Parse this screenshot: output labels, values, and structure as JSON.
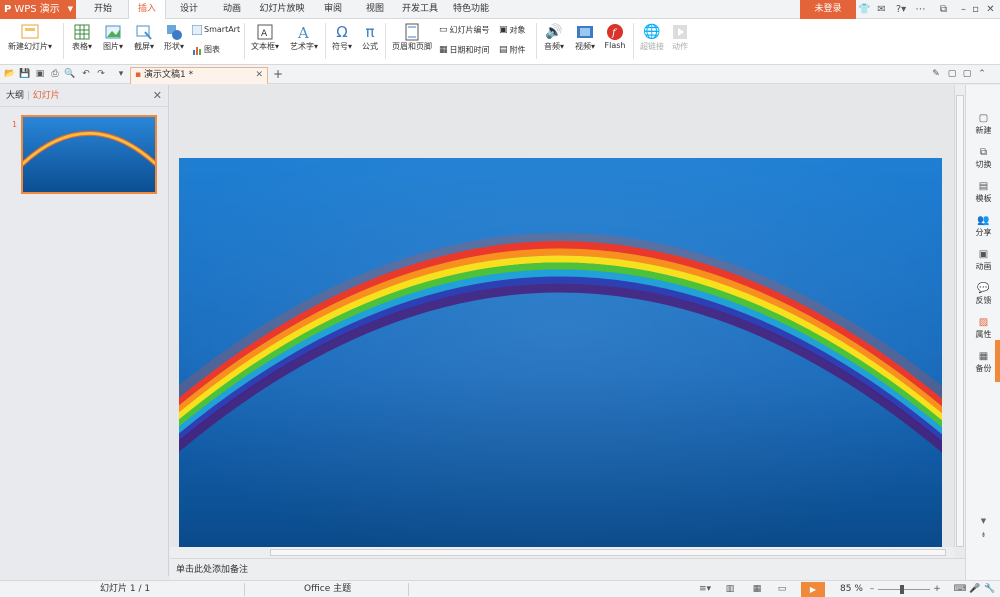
{
  "app": {
    "logo": "P",
    "name": "WPS 演示"
  },
  "menu": {
    "tabs": [
      {
        "label": "开始"
      },
      {
        "label": "插入"
      },
      {
        "label": "设计"
      },
      {
        "label": "动画"
      },
      {
        "label": "幻灯片放映"
      },
      {
        "label": "审阅"
      },
      {
        "label": "视图"
      },
      {
        "label": "开发工具"
      },
      {
        "label": "特色功能"
      }
    ],
    "active": "插入",
    "login_label": "未登录"
  },
  "ribbon": {
    "new_slide": "新建幻灯片",
    "table": "表格",
    "picture": "图片",
    "screenshot": "截屏",
    "shape": "形状",
    "smartart": "SmartArt",
    "chart": "图表",
    "textbox": "文本框",
    "wordart": "艺术字",
    "symbol": "符号",
    "formula": "公式",
    "header_footer": "页眉和页脚",
    "slide_number": "幻灯片编号",
    "datetime": "日期和时间",
    "object": "对象",
    "attachment": "附件",
    "audio": "音频",
    "video": "视频",
    "flash": "Flash",
    "hyperlink": "超链接",
    "action": "动作"
  },
  "quickbar": {
    "doc_tab": "演示文稿1 *",
    "new_tab": "+"
  },
  "leftpanel": {
    "tab_outline": "大纲",
    "tab_slides": "幻灯片",
    "slide_index": "1"
  },
  "rightpane": {
    "items": [
      {
        "label": "新建"
      },
      {
        "label": "切换"
      },
      {
        "label": "模板"
      },
      {
        "label": "分享"
      },
      {
        "label": "动画"
      },
      {
        "label": "反馈"
      },
      {
        "label": "属性"
      },
      {
        "label": "备份"
      }
    ]
  },
  "notes": {
    "placeholder": "单击此处添加备注"
  },
  "status": {
    "slide_info": "幻灯片 1 / 1",
    "theme": "Office 主题",
    "zoom": "85 %"
  },
  "colors": {
    "accent": "#e4643a",
    "slide_top": "#1a78cc",
    "slide_bottom": "#0a4a8a"
  }
}
